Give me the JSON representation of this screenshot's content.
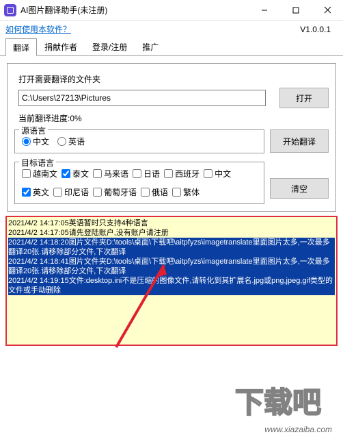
{
  "window": {
    "title": "AI图片翻译助手(未注册)"
  },
  "link": {
    "how_to_use": "如何使用本软件？"
  },
  "version": "V1.0.0.1",
  "tabs": {
    "translate": "翻译",
    "donate": "捐献作者",
    "login": "登录/注册",
    "promote": "推广"
  },
  "open_folder": {
    "label": "打开需要翻译的文件夹",
    "path": "C:\\Users\\27213\\Pictures",
    "button": "打开"
  },
  "progress": {
    "label": "当前翻译进度:0%"
  },
  "source_lang": {
    "legend": "源语言",
    "zh": "中文",
    "en": "英语"
  },
  "start_btn": "开始翻译",
  "target_lang": {
    "legend": "目标语言",
    "vi": "越南文",
    "th": "泰文",
    "ms": "马来语",
    "ja": "日语",
    "es": "西班牙",
    "zh": "中文",
    "en": "英文",
    "id": "印尼语",
    "pt": "葡萄牙语",
    "ru": "俄语",
    "tw": "繁体"
  },
  "clear_btn": "清空",
  "log": {
    "l1": "2021/4/2 14:17:05英语暂时只支持4种语言",
    "l2": "2021/4/2 14:17:05请先登陆账户,没有账户请注册",
    "l3": "2021/4/2 14:18:20图片文件夹D:\\tools\\桌面\\下载吧\\aitpfyzs\\imagetranslate里面图片太多,一次最多翻译20张.请移除部分文件,下次翻译",
    "l4": "2021/4/2 14:18:41图片文件夹D:\\tools\\桌面\\下载吧\\aitpfyzs\\imagetranslate里面图片太多,一次最多翻译20张.请移除部分文件,下次翻译",
    "l5": "2021/4/2 14:19:15文件:desktop.ini不是压缩的图像文件,请转化到其扩展名.jpg或png,jpeg,gif类型的文件或手动删除"
  },
  "watermark": {
    "text": "下载吧",
    "url": "www.xiazaiba.com"
  }
}
